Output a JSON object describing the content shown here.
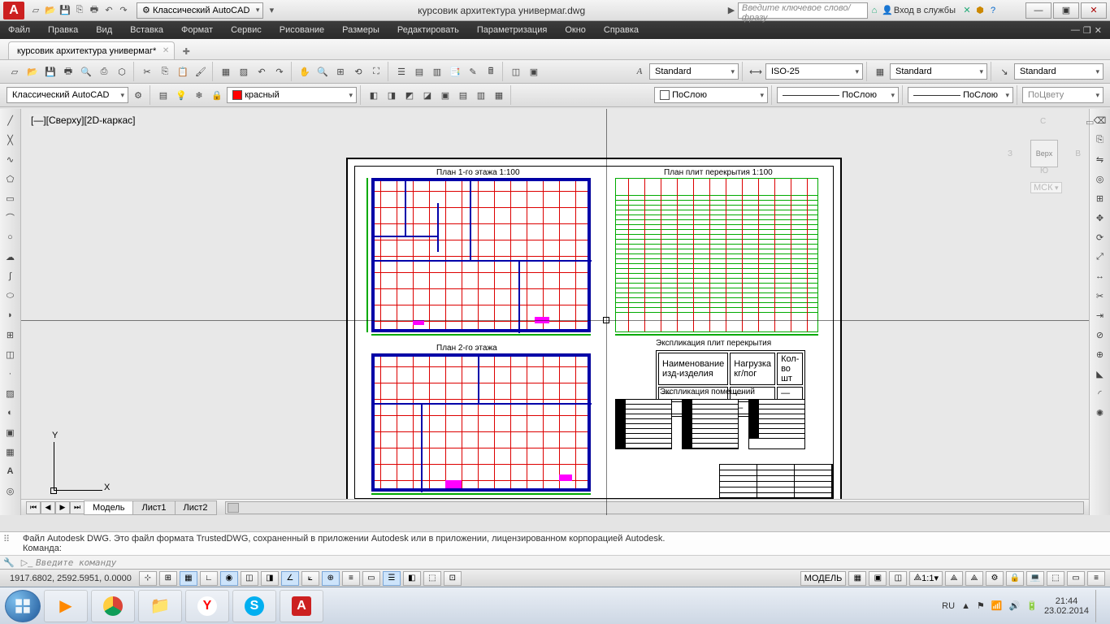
{
  "title_doc": "курсовик архитектура универмаг.dwg",
  "workspace": "Классический AutoCAD",
  "help_placeholder": "Введите ключевое слово/фразу",
  "signin": "Вход в службы",
  "menus": [
    "Файл",
    "Правка",
    "Вид",
    "Вставка",
    "Формат",
    "Сервис",
    "Рисование",
    "Размеры",
    "Редактировать",
    "Параметризация",
    "Окно",
    "Справка"
  ],
  "doc_tab": "курсовик архитектура универмаг*",
  "style_text": "Standard",
  "dimstyle": "ISO-25",
  "tablestyle": "Standard",
  "mlstyle": "Standard",
  "workspace2": "Классический AutoCAD",
  "layer_color": "красный",
  "bylayer": "ПоСлою",
  "bycolor": "ПоЦвету",
  "viewport_label": "[—][Сверху][2D-каркас]",
  "nav_top": "Верх",
  "nav_n": "С",
  "nav_s": "Ю",
  "nav_e": "В",
  "nav_w": "З",
  "nav_wcs": "МСК",
  "plan1_title": "План 1-го этажа 1:100",
  "plan2_title": "План 2-го этажа",
  "slab_title": "План плит перекрытия 1:100",
  "expl_slab": "Экспликация плит перекрытия",
  "expl_room": "Экспликация помещений",
  "table_h1": "Наименование изд-изделия",
  "table_h2": "Нагрузка кг/пог",
  "table_h3": "Кол-во шт",
  "model_tab": "Модель",
  "layout1": "Лист1",
  "layout2": "Лист2",
  "cmd_log1": "Файл Autodesk DWG. Это файл формата TrustedDWG, сохраненный в приложении Autodesk или в приложении, лицензированном корпорацией Autodesk.",
  "cmd_log2": "Команда:",
  "cmd_prompt": "Введите команду",
  "coords": "1917.6802, 2592.5951, 0.0000",
  "sb_model": "МОДЕЛЬ",
  "sb_scale": "1:1",
  "lang": "RU",
  "time": "21:44",
  "date": "23.02.2014"
}
